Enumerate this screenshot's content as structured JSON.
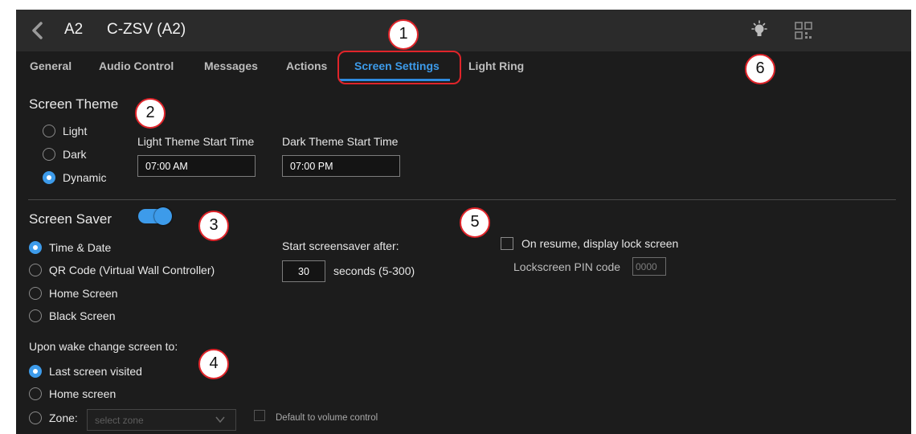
{
  "header": {
    "device_code": "A2",
    "device_name": "C-ZSV (A2)"
  },
  "tabs": [
    {
      "label": "General"
    },
    {
      "label": "Audio Control"
    },
    {
      "label": "Messages"
    },
    {
      "label": "Actions"
    },
    {
      "label": "Screen Settings",
      "active": true
    },
    {
      "label": "Light Ring"
    }
  ],
  "screen_theme": {
    "title": "Screen Theme",
    "options": [
      "Light",
      "Dark",
      "Dynamic"
    ],
    "selected": "Dynamic",
    "light_start_label": "Light Theme Start Time",
    "light_start_value": "07:00 AM",
    "dark_start_label": "Dark Theme Start Time",
    "dark_start_value": "07:00 PM"
  },
  "screen_saver": {
    "title": "Screen Saver",
    "enabled": true,
    "options": [
      "Time & Date",
      "QR Code (Virtual Wall Controller)",
      "Home Screen",
      "Black Screen"
    ],
    "selected": "Time & Date",
    "start_after_label": "Start screensaver after:",
    "start_after_value": "30",
    "start_after_unit": "seconds (5-300)",
    "lock_label": "On resume, display lock screen",
    "lock_checked": false,
    "pin_label": "Lockscreen PIN code",
    "pin_placeholder": "0000"
  },
  "wake": {
    "title": "Upon wake change screen to:",
    "options": [
      "Last screen visited",
      "Home screen",
      "Zone:"
    ],
    "selected": "Last screen visited",
    "zone_placeholder": "select zone",
    "default_volume_label": "Default to volume control"
  },
  "callouts": [
    "1",
    "2",
    "3",
    "4",
    "5",
    "6"
  ],
  "colors": {
    "accent": "#3d9bea",
    "callout_border": "#e0242a",
    "background": "#1c1c1c",
    "header": "#2b2b2b"
  }
}
